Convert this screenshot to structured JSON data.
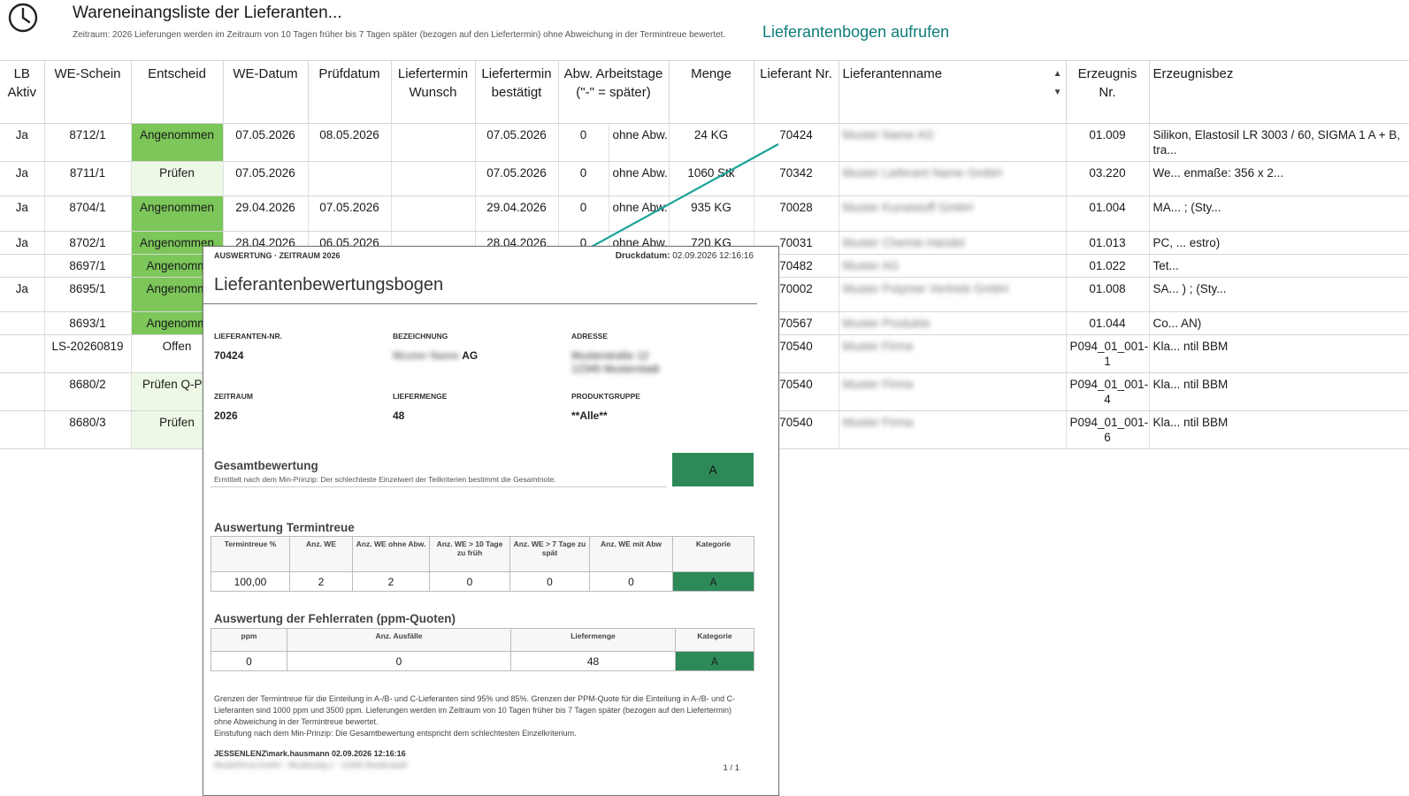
{
  "header": {
    "title": "Wareneinangsliste der Lieferanten...",
    "subline": "Zeitraum: 2026 Lieferungen werden im Zeitraum von 10 Tagen früher bis 7 Tagen später (bezogen auf den Liefertermin) ohne Abweichung in der Termintreue bewertet.",
    "link": "Lieferantenbogen aufrufen",
    "icon": "clock-icon"
  },
  "grid": {
    "columns": [
      "LB Aktiv",
      "WE-Schein",
      "Entscheid",
      "WE-Datum",
      "Prüfdatum",
      "Liefertermin Wunsch",
      "Liefertermin bestätigt",
      "Abw. Arbeitstage (\"-\" = später)",
      "Menge",
      "Lieferant Nr.",
      "Lieferantenname",
      "Erzeugnis Nr.",
      "Erzeugnisbez"
    ],
    "rows": [
      {
        "lb": "Ja",
        "we": "8712/1",
        "entscheid": "Angenommen",
        "we_datum": "07.05.2026",
        "pruef": "08.05.2026",
        "wunsch": "",
        "best": "07.05.2026",
        "abw": "0",
        "abw_text": "ohne Abw.",
        "menge": "24 KG",
        "lief_nr": "70424",
        "lief_name": "Muster Name AG",
        "erz_nr": "01.009",
        "erz_bez": "Silikon, Elastosil LR 3003 / 60, SIGMA 1 A + B, tra..."
      },
      {
        "lb": "Ja",
        "we": "8711/1",
        "entscheid": "Prüfen",
        "we_datum": "07.05.2026",
        "pruef": "",
        "wunsch": "",
        "best": "07.05.2026",
        "abw": "0",
        "abw_text": "ohne Abw.",
        "menge": "1060 Stk",
        "lief_nr": "70342",
        "lief_name": "Muster Lieferant Name GmbH",
        "erz_nr": "03.220",
        "erz_bez": "We... enmaße: 356 x 2..."
      },
      {
        "lb": "Ja",
        "we": "8704/1",
        "entscheid": "Angenommen",
        "we_datum": "29.04.2026",
        "pruef": "07.05.2026",
        "wunsch": "",
        "best": "29.04.2026",
        "abw": "0",
        "abw_text": "ohne Abw.",
        "menge": "935 KG",
        "lief_nr": "70028",
        "lief_name": "Muster Kunststoff GmbH",
        "erz_nr": "01.004",
        "erz_bez": "MA... ; (Sty..."
      },
      {
        "lb": "Ja",
        "we": "8702/1",
        "entscheid": "Angenommen",
        "we_datum": "28.04.2026",
        "pruef": "06.05.2026",
        "wunsch": "",
        "best": "28.04.2026",
        "abw": "0",
        "abw_text": "ohne Abw.",
        "menge": "720 KG",
        "lief_nr": "70031",
        "lief_name": "Muster Chemie Handel",
        "erz_nr": "01.013",
        "erz_bez": "PC, ... estro)"
      },
      {
        "lb": "",
        "we": "8697/1",
        "entscheid": "Angenomm",
        "we_datum": "",
        "pruef": "",
        "wunsch": "",
        "best": "",
        "abw": "",
        "abw_text": "",
        "menge": "",
        "lief_nr": "70482",
        "lief_name": "Muster AG",
        "erz_nr": "01.022",
        "erz_bez": "Tet..."
      },
      {
        "lb": "Ja",
        "we": "8695/1",
        "entscheid": "Angenomm",
        "we_datum": "",
        "pruef": "",
        "wunsch": "",
        "best": "",
        "abw": "",
        "abw_text": "",
        "menge": "",
        "lief_nr": "70002",
        "lief_name": "Muster Polymer Vertrieb GmbH",
        "erz_nr": "01.008",
        "erz_bez": "SA... ) ; (Sty..."
      },
      {
        "lb": "",
        "we": "8693/1",
        "entscheid": "Angenomm",
        "we_datum": "",
        "pruef": "",
        "wunsch": "",
        "best": "",
        "abw": "",
        "abw_text": "",
        "menge": "",
        "lief_nr": "70567",
        "lief_name": "Muster Produkte",
        "erz_nr": "01.044",
        "erz_bez": "Co... AN)"
      },
      {
        "lb": "",
        "we": "LS-20260819",
        "entscheid": "Offen",
        "we_datum": "",
        "pruef": "",
        "wunsch": "",
        "best": "",
        "abw": "",
        "abw_text": "",
        "menge": "",
        "lief_nr": "70540",
        "lief_name": "Muster Firma",
        "erz_nr": "P094_01_001-1",
        "erz_bez": "Kla... ntil BBM"
      },
      {
        "lb": "",
        "we": "8680/2",
        "entscheid": "Prüfen Q-Pla",
        "we_datum": "",
        "pruef": "",
        "wunsch": "",
        "best": "",
        "abw": "",
        "abw_text": "",
        "menge": "",
        "lief_nr": "70540",
        "lief_name": "Muster Firma",
        "erz_nr": "P094_01_001-4",
        "erz_bez": "Kla... ntil BBM"
      },
      {
        "lb": "",
        "we": "8680/3",
        "entscheid": "Prüfen",
        "we_datum": "",
        "pruef": "",
        "wunsch": "",
        "best": "",
        "abw": "",
        "abw_text": "",
        "menge": "",
        "lief_nr": "70540",
        "lief_name": "Muster Firma",
        "erz_nr": "P094_01_001-6",
        "erz_bez": "Kla... ntil BBM"
      }
    ]
  },
  "report": {
    "top": "AUSWERTUNG · ZEITRAUM 2026",
    "print_label": "Druckdatum:",
    "print_value": "02.09.2026 12:16:16",
    "title": "Lieferantenbewertungsbogen",
    "labels": {
      "nr": "LIEFERANTEN-NR.",
      "bez": "BEZEICHNUNG",
      "adr": "ADRESSE",
      "zeitraum": "ZEITRAUM",
      "menge": "LIEFERMENGE",
      "gruppe": "PRODUKTGRUPPE"
    },
    "values": {
      "nr": "70424",
      "bez_blur": "Muster Name",
      "bez_suffix": "AG",
      "adr_blur_1": "Musterstraße 12",
      "adr_blur_2": "12345 Musterstadt",
      "zeitraum": "2026",
      "menge": "48",
      "gruppe": "**Alle**"
    },
    "gesamt": {
      "heading": "Gesamtbewertung",
      "note": "Ermittelt nach dem Min-Prinzip: Der schlechteste Einzelwert der Teilkriterien bestimmt die Gesamtnote.",
      "grade": "A",
      "grade_color": "#2d8a58"
    },
    "termin": {
      "heading": "Auswertung Termintreue",
      "cols": [
        "Termintreue %",
        "Anz. WE",
        "Anz. WE ohne Abw.",
        "Anz. WE > 10 Tage zu früh",
        "Anz. WE > 7 Tage zu spät",
        "Anz. WE mit Abw",
        "Kategorie"
      ],
      "values": [
        "100,00",
        "2",
        "2",
        "0",
        "0",
        "0",
        "A"
      ]
    },
    "fehler": {
      "heading": "Auswertung der Fehlerraten (ppm-Quoten)",
      "cols": [
        "ppm",
        "Anz. Ausfälle",
        "Liefermenge",
        "Kategorie"
      ],
      "values": [
        "0",
        "0",
        "48",
        "A"
      ]
    },
    "footer_1": "Grenzen der Termintreue für die Einteilung in A-/B- und C-Lieferanten sind 95% und 85%. Grenzen der PPM-Quote für die Einteilung in A-/B- und C-Lieferanten sind 1000 ppm und 3500 ppm. Lieferungen werden im Zeitraum von 10 Tagen früher bis 7 Tagen später (bezogen auf den Liefertermin) ohne Abweichung in der Termintreue bewertet.",
    "footer_2": "Einstufung nach dem Min-Prinzip: Die Gesamtbewertung entspricht dem schlechtesten Einzelkriterium.",
    "user": "JESSENLENZ\\mark.hausmann 02.09.2026 12:16:16",
    "user_blur": "Musterfirma GmbH · Musterweg 1 · 12345 Musterstadt",
    "page": "1 / 1"
  },
  "colors": {
    "accepted": "#7cc65a",
    "check": "#edf9e6",
    "link": "#0e7c7b",
    "arrow": "#1aa39a"
  }
}
